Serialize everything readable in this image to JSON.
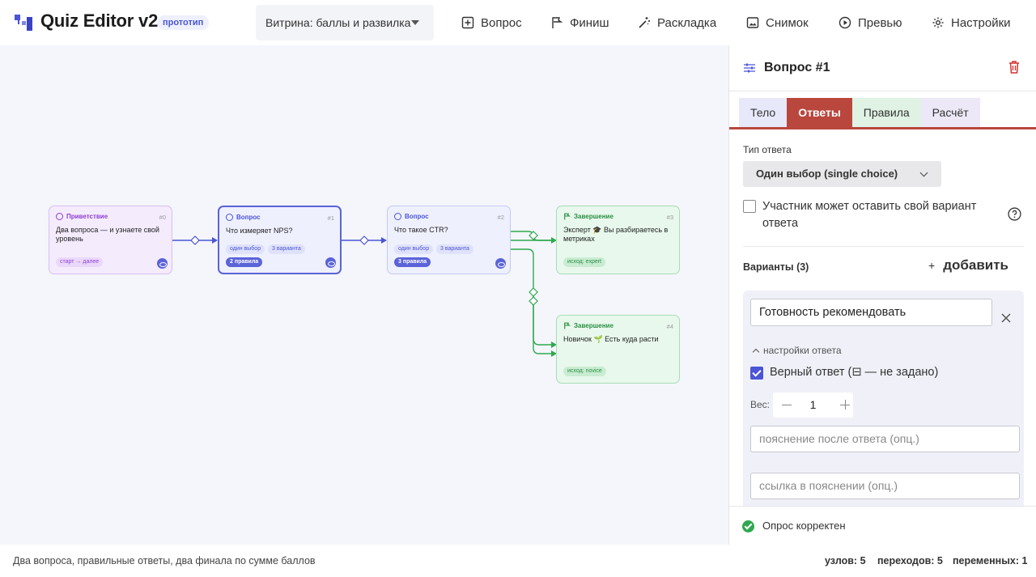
{
  "header": {
    "title": "Quiz Editor v2",
    "badge": "прототип",
    "scenario": "Витрина: баллы и развилка",
    "toolbar": {
      "question": "Вопрос",
      "finish": "Финиш",
      "layout": "Раскладка",
      "snapshot": "Снимок",
      "preview": "Превью",
      "settings": "Настройки"
    }
  },
  "canvas": {
    "nodes": [
      {
        "kind": "Приветствие",
        "index": "#0",
        "title": "Два вопроса — и узнаете свой уровень",
        "chips": [
          "старт → далее"
        ]
      },
      {
        "kind": "Вопрос",
        "index": "#1",
        "title": "Что измеряет NPS?",
        "chips": [
          "один выбор",
          "3 варианта"
        ],
        "rules": "2 правила"
      },
      {
        "kind": "Вопрос",
        "index": "#2",
        "title": "Что такое CTR?",
        "chips": [
          "один выбор",
          "3 варианта"
        ],
        "rules": "3 правила"
      },
      {
        "kind": "Завершение",
        "index": "#3",
        "title": "Эксперт 🎓 Вы разбираетесь в метриках",
        "chips": [
          "исход: expert"
        ]
      },
      {
        "kind": "Завершение",
        "index": "#4",
        "title": "Новичок 🌱 Есть куда расти",
        "chips": [
          "исход: novice"
        ]
      }
    ]
  },
  "panel": {
    "title": "Вопрос #1",
    "tabs": [
      "Тело",
      "Ответы",
      "Правила",
      "Расчёт"
    ],
    "answer_type_label": "Тип ответа",
    "answer_type_value": "Один выбор (single choice)",
    "own_variant_label": "Участник может оставить свой вариант ответа",
    "variants_label": "Варианты (3)",
    "add_label": "добавить",
    "variant": {
      "text": "Готовность рекомендовать",
      "settings_toggle": "настройки ответа",
      "correct_label": "Верный ответ (⊟ — не задано)",
      "weight_label": "Вес:",
      "weight_value": "1",
      "explanation_placeholder": "пояснение после ответа (опц.)",
      "link_placeholder": "ссылка в пояснении (опц.)"
    },
    "status": "Опрос корректен"
  },
  "footer": {
    "description": "Два вопроса, правильные ответы, два финала по сумме баллов",
    "nodes": "узлов: 5",
    "transitions": "переходов: 5",
    "variables": "переменных: 1"
  },
  "colors": {
    "accent": "#5b63d9",
    "active_tab": "#b9473e",
    "finish": "#2fa84f",
    "canvas_bg": "#f4f6fb"
  }
}
